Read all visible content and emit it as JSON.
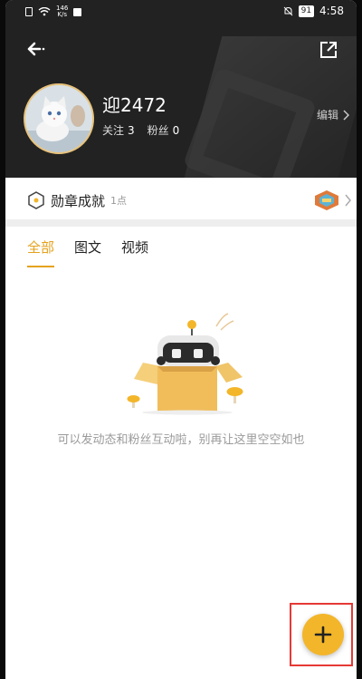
{
  "status_bar": {
    "speed_top": "146",
    "speed_bottom": "K/s",
    "battery": "91",
    "time": "4:58"
  },
  "profile": {
    "username": "迎2472",
    "follow_label": "关注",
    "follow_count": "3",
    "fans_label": "粉丝",
    "fans_count": "0",
    "edit_label": "编辑"
  },
  "badges": {
    "title": "勋章成就",
    "points": "1点"
  },
  "tabs": [
    {
      "label": "全部",
      "active": true
    },
    {
      "label": "图文",
      "active": false
    },
    {
      "label": "视频",
      "active": false
    }
  ],
  "empty_state": {
    "message": "可以发动态和粉丝互动啦，别再让这里空空如也"
  },
  "colors": {
    "accent": "#e5a21d",
    "fab": "#f3b62a",
    "header_bg": "#222222",
    "highlight_box": "#e53935"
  },
  "icons": {
    "back": "back-arrow-icon",
    "share": "share-icon",
    "fab": "plus-icon",
    "badge": "hexagon-badge-icon"
  }
}
